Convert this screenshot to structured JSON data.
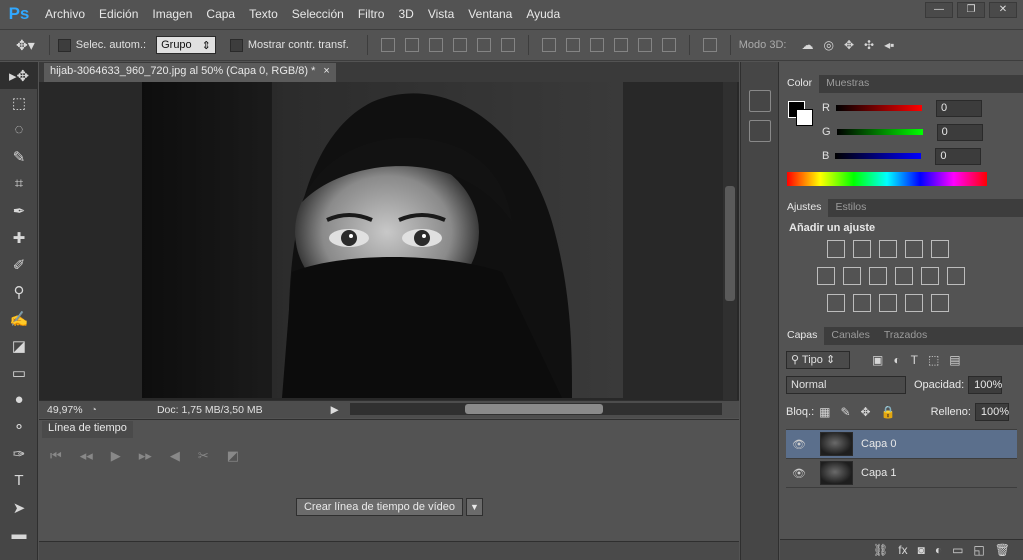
{
  "menubar": {
    "logo": "Ps",
    "items": [
      "Archivo",
      "Edición",
      "Imagen",
      "Capa",
      "Texto",
      "Selección",
      "Filtro",
      "3D",
      "Vista",
      "Ventana",
      "Ayuda"
    ]
  },
  "options": {
    "auto_select_label": "Selec. autom.:",
    "group_value": "Grupo",
    "show_transform_label": "Mostrar contr. transf.",
    "mode3d_label": "Modo 3D:"
  },
  "document": {
    "tab_title": "hijab-3064633_960_720.jpg al 50% (Capa 0, RGB/8) *",
    "close_glyph": "×",
    "zoom": "49,97%",
    "doc_info": "Doc: 1,75 MB/3,50 MB"
  },
  "timeline": {
    "tab_label": "Línea de tiempo",
    "create_button": "Crear línea de tiempo de vídeo"
  },
  "color_panel": {
    "tabs": [
      "Color",
      "Muestras"
    ],
    "channels": [
      {
        "label": "R",
        "value": "0",
        "color": "#ff0000"
      },
      {
        "label": "G",
        "value": "0",
        "color": "#00ff00"
      },
      {
        "label": "B",
        "value": "0",
        "color": "#0000ff"
      }
    ]
  },
  "adjust_panel": {
    "tabs": [
      "Ajustes",
      "Estilos"
    ],
    "heading": "Añadir un ajuste"
  },
  "layers_panel": {
    "tabs": [
      "Capas",
      "Canales",
      "Trazados"
    ],
    "filter_kind": "Tipo",
    "blend_mode": "Normal",
    "opacity_label": "Opacidad:",
    "opacity_value": "100%",
    "lock_label": "Bloq.:",
    "fill_label": "Relleno:",
    "fill_value": "100%",
    "layers": [
      {
        "name": "Capa 0",
        "selected": true
      },
      {
        "name": "Capa 1",
        "selected": false
      }
    ]
  }
}
